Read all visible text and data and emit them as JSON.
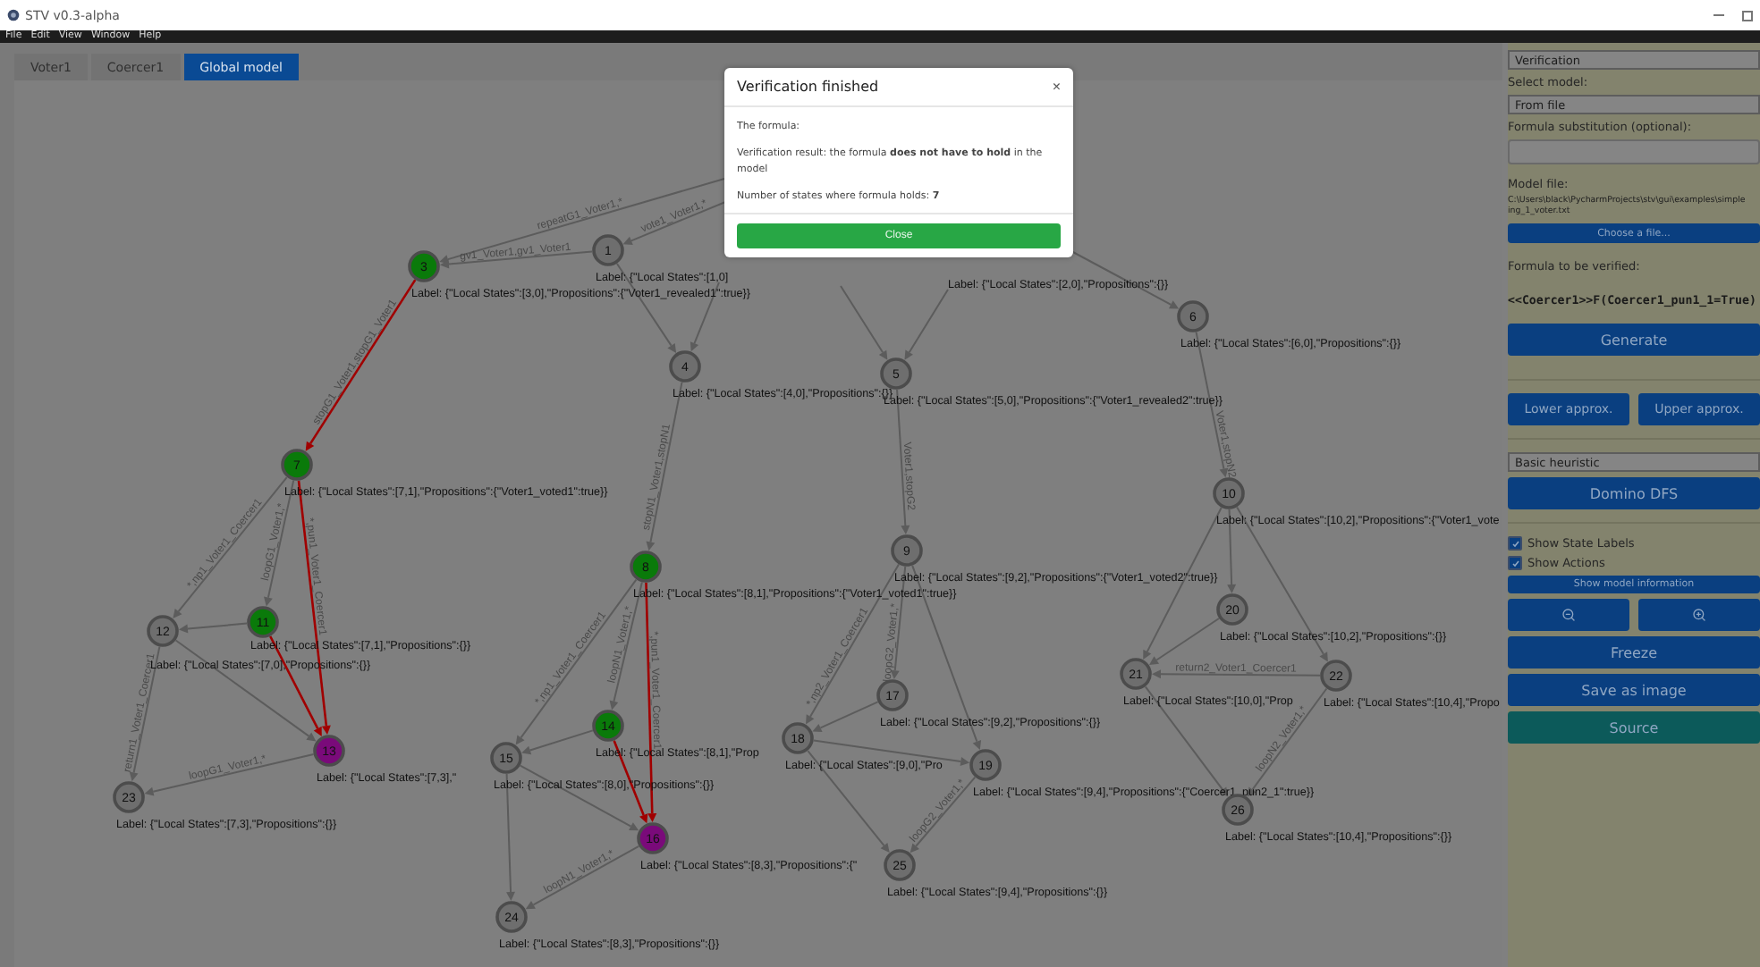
{
  "window": {
    "title": "STV v0.3-alpha"
  },
  "menu": [
    "File",
    "Edit",
    "View",
    "Window",
    "Help"
  ],
  "tabs": [
    {
      "label": "Voter1",
      "selected": false
    },
    {
      "label": "Coercer1",
      "selected": false
    },
    {
      "label": "Global model",
      "selected": true
    }
  ],
  "graph": {
    "nodes": [
      {
        "label": "1",
        "color": "#6e6e6e",
        "caption": "Label: {\"Local States\":[1,0]"
      },
      {
        "label": "3",
        "color": "#0a7a0a",
        "caption": "Label: {\"Local States\":[3,0],\"Propositions\":{\"Voter1_revealed1\":true}}"
      },
      {
        "label": "4",
        "color": "#6e6e6e",
        "caption": "Label: {\"Local States\":[4,0],\"Propositions\":{}}"
      },
      {
        "label": "5",
        "color": "#6e6e6e",
        "caption": "Label: {\"Local States\":[5,0],\"Propositions\":{\"Voter1_revealed2\":true}}"
      },
      {
        "label": "6",
        "color": "#6e6e6e",
        "caption": "Label: {\"Local States\":[6,0],\"Propositions\":{}}"
      },
      {
        "label": "7",
        "color": "#0a7a0a",
        "caption": "Label: {\"Local States\":[7,1],\"Propositions\":{\"Voter1_voted1\":true}}"
      },
      {
        "label": "8",
        "color": "#0a7a0a",
        "caption": "Label: {\"Local States\":[8,1],\"Propositions\":{\"Voter1_voted1\":true}}"
      },
      {
        "label": "9",
        "color": "#6e6e6e",
        "caption": "Label: {\"Local States\":[9,2],\"Propositions\":{\"Voter1_voted2\":true}}"
      },
      {
        "label": "10",
        "color": "#6e6e6e",
        "caption": "Label: {\"Local States\":[10,2],\"Propositions\":{\"Voter1_vote"
      },
      {
        "label": "11",
        "color": "#0a7a0a",
        "caption": "Label: {\"Local States\":[7,1],\"Propositions\":{}}"
      },
      {
        "label": "12",
        "color": "#6e6e6e",
        "caption": "Label: {\"Local States\":[7,0],\"Propositions\":{}}"
      },
      {
        "label": "13",
        "color": "#7a0a7a",
        "caption": "Label: {\"Local States\":[7,3],\""
      },
      {
        "label": "14",
        "color": "#0a7a0a",
        "caption": "Label: {\"Local States\":[8,1],\"Prop"
      },
      {
        "label": "15",
        "color": "#6e6e6e",
        "caption": "Label: {\"Local States\":[8,0],\"Propositions\":{}}"
      },
      {
        "label": "16",
        "color": "#7a0a7a",
        "caption": "Label: {\"Local States\":[8,3],\"Propositions\":{\""
      },
      {
        "label": "17",
        "color": "#6e6e6e",
        "caption": "Label: {\"Local States\":[9,2],\"Propositions\":{}}"
      },
      {
        "label": "18",
        "color": "#6e6e6e",
        "caption": "Label: {\"Local States\":[9,0],\"Pro"
      },
      {
        "label": "19",
        "color": "#6e6e6e",
        "caption": "Label: {\"Local States\":[9,4],\"Propositions\":{\"Coercer1_pun2_1\":true}}"
      },
      {
        "label": "20",
        "color": "#6e6e6e",
        "caption": "Label: {\"Local States\":[10,2],\"Propositions\":{}}"
      },
      {
        "label": "21",
        "color": "#6e6e6e",
        "caption": "Label: {\"Local States\":[10,0],\"Prop"
      },
      {
        "label": "22",
        "color": "#6e6e6e",
        "caption": "Label: {\"Local States\":[10,4],\"Propo"
      },
      {
        "label": "23",
        "color": "#6e6e6e",
        "caption": "Label: {\"Local States\":[7,3],\"Propositions\":{}}"
      },
      {
        "label": "24",
        "color": "#6e6e6e",
        "caption": "Label: {\"Local States\":[8,3],\"Propositions\":{}}"
      },
      {
        "label": "25",
        "color": "#6e6e6e",
        "caption": "Label: {\"Local States\":[9,4],\"Propositions\":{}}"
      },
      {
        "label": "26",
        "color": "#6e6e6e",
        "caption": "Label: {\"Local States\":[10,4],\"Propositions\":{}}"
      }
    ],
    "extra_captions": [
      "Label: {\"Local States\":[2,0],\"Propositions\":{}}"
    ],
    "edges": [
      {
        "label": "repeatG1_Voter1,*",
        "highlighted": false
      },
      {
        "label": "vote1_Voter1,*",
        "highlighted": false
      },
      {
        "label": "gv1_Voter1,gv1_Voter1",
        "highlighted": false
      },
      {
        "highlighted": false
      },
      {
        "label": "stopG1_Voter1,stopG1_Voter1",
        "highlighted": true
      },
      {
        "label": "stopN1_Voter1,stopN1",
        "highlighted": false
      },
      {
        "highlighted": false
      },
      {
        "highlighted": false
      },
      {
        "highlighted": false
      },
      {
        "highlighted": false
      },
      {
        "label": "Voter1,stopG2",
        "highlighted": false
      },
      {
        "label": "Voter1,stopN2",
        "highlighted": false
      },
      {
        "label": "*,np1_Voter1_Coercer1",
        "highlighted": false
      },
      {
        "label": "loopG1_Voter1,*",
        "highlighted": false
      },
      {
        "label": "*,pun1_Voter1_Coercer1",
        "highlighted": true
      },
      {
        "highlighted": false
      },
      {
        "highlighted": true
      },
      {
        "highlighted": false
      },
      {
        "label": "return1_Voter1_Coercer1",
        "highlighted": false
      },
      {
        "label": "loopG1_Voter1,*",
        "highlighted": false
      },
      {
        "label": "*,np1_Voter1_Coercer1",
        "highlighted": false
      },
      {
        "label": "loopN1_Voter1,*",
        "highlighted": false
      },
      {
        "label": "*,pun1_Voter1_Coercer1",
        "highlighted": true
      },
      {
        "highlighted": false
      },
      {
        "highlighted": true
      },
      {
        "highlighted": false
      },
      {
        "highlighted": false
      },
      {
        "label": "loopN1_Voter1,*",
        "highlighted": false
      },
      {
        "label": "*,np2_Voter1_Coercer1",
        "highlighted": false
      },
      {
        "label": "loopG2_Voter1,*",
        "highlighted": false
      },
      {
        "highlighted": false
      },
      {
        "highlighted": false
      },
      {
        "highlighted": false
      },
      {
        "highlighted": false
      },
      {
        "label": "loopG2_Voter1,*",
        "highlighted": false
      },
      {
        "highlighted": false
      },
      {
        "highlighted": false
      },
      {
        "highlighted": false
      },
      {
        "highlighted": false
      },
      {
        "label": "return2_Voter1_Coercer1",
        "highlighted": false
      },
      {
        "highlighted": false
      },
      {
        "label": "loopN2_Voter1,*",
        "highlighted": false
      }
    ]
  },
  "panel": {
    "mode_select": "Verification",
    "select_model_label": "Select model:",
    "model_select": "From file",
    "substitution_label": "Formula substitution (optional):",
    "model_file_label": "Model file:",
    "model_path_lines": [
      "C:\\Users\\black\\PycharmProjects\\stv\\gui\\examples\\simple",
      "ing_1_voter.txt"
    ],
    "choose_file_button": "Choose a file...",
    "formula_label": "Formula to be verified:",
    "formula": "<<Coercer1>>F(Coercer1_pun1_1=True)",
    "generate_button": "Generate",
    "approx_buttons": [
      "Lower approx.",
      "Upper approx."
    ],
    "heuristic_select": "Basic heuristic",
    "dfs_button": "Domino DFS",
    "checkboxes": [
      {
        "label": "Show State Labels",
        "checked": true
      },
      {
        "label": "Show Actions",
        "checked": true
      }
    ],
    "model_info_button": "Show model information",
    "action_buttons": [
      {
        "label": "Freeze",
        "kind": "primary"
      },
      {
        "label": "Save as image",
        "kind": "primary"
      },
      {
        "label": "Source",
        "kind": "secondary"
      }
    ]
  },
  "dialog": {
    "title": "Verification finished",
    "close_icon": "×",
    "lines": [
      "The formula:",
      "Verification result: the formula **does not have to hold** in the model",
      "Number of states where formula holds: **7**"
    ],
    "button": "Close"
  }
}
